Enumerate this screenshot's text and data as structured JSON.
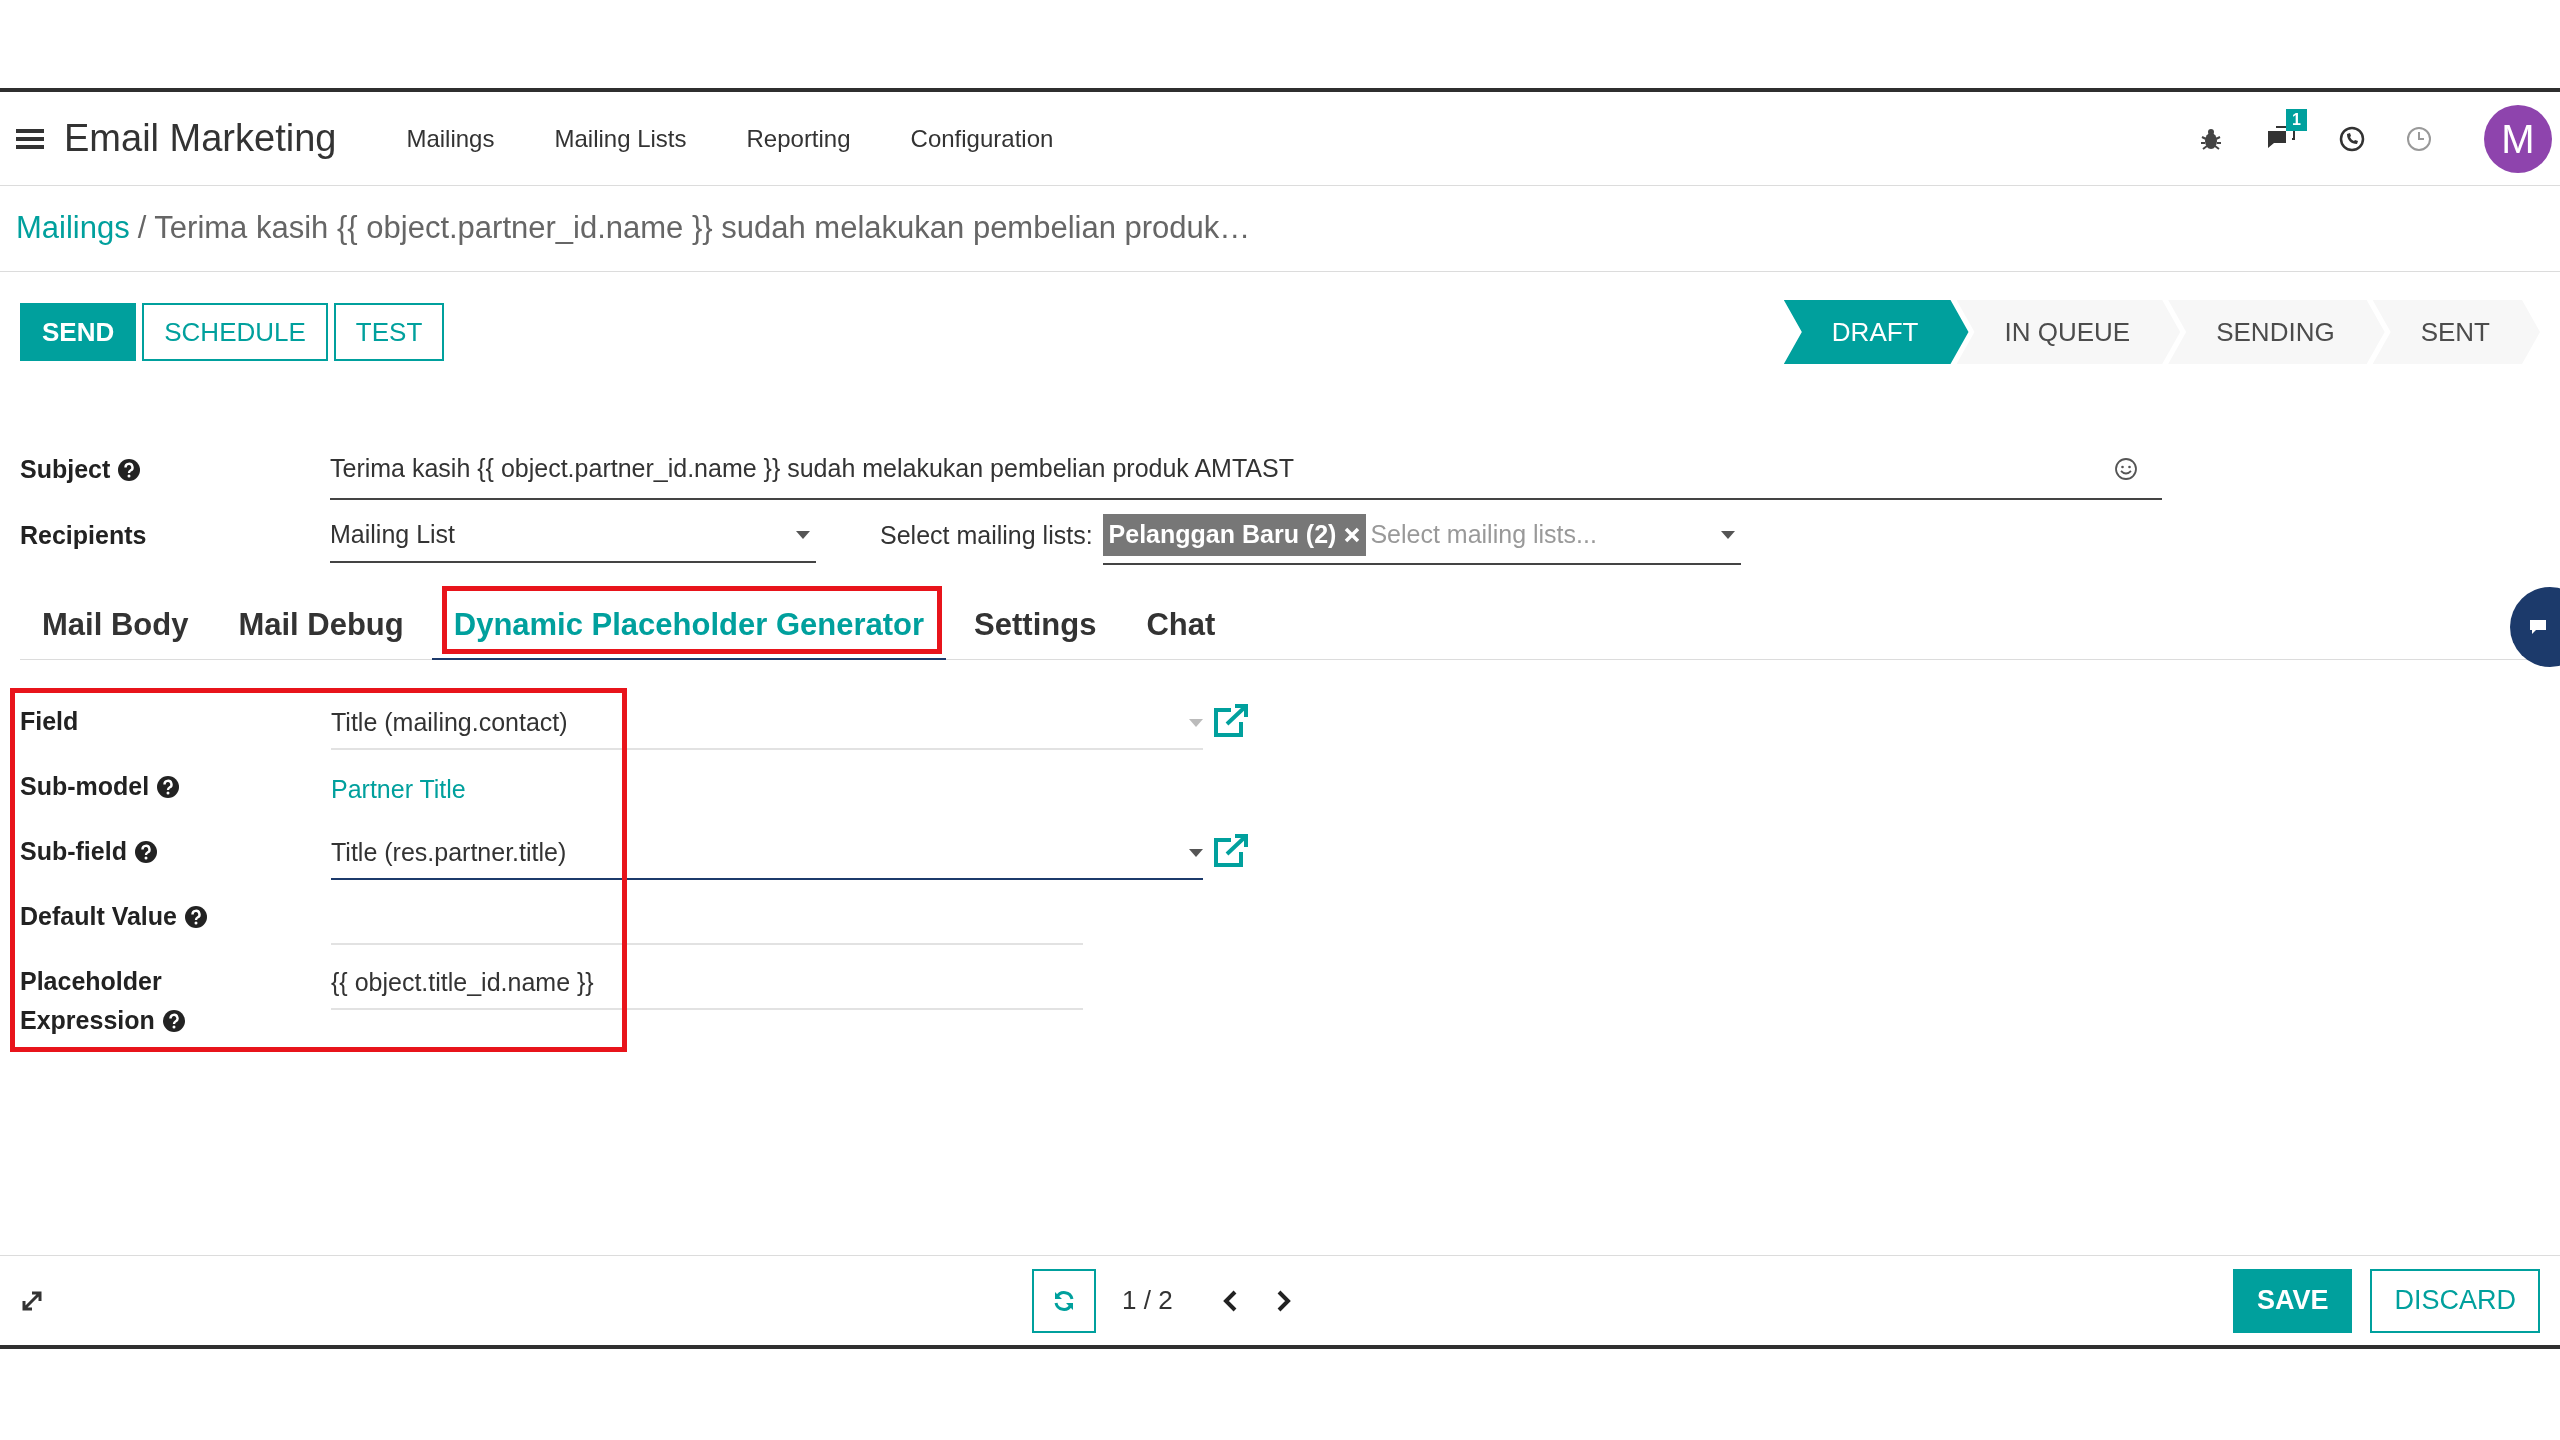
{
  "app_title": "Email Marketing",
  "menu": [
    "Mailings",
    "Mailing Lists",
    "Reporting",
    "Configuration"
  ],
  "systray": {
    "message_count": "1",
    "avatar_letter": "M"
  },
  "breadcrumb": {
    "parent": "Mailings",
    "separator": "/",
    "current": "Terima kasih {{ object.partner_id.name }} sudah melakukan pembelian produk…"
  },
  "actions": [
    {
      "label": "SEND",
      "kind": "primary"
    },
    {
      "label": "SCHEDULE",
      "kind": "secondary"
    },
    {
      "label": "TEST",
      "kind": "secondary"
    }
  ],
  "stages": [
    {
      "label": "DRAFT",
      "selected": true
    },
    {
      "label": "IN QUEUE",
      "selected": false
    },
    {
      "label": "SENDING",
      "selected": false
    },
    {
      "label": "SENT",
      "selected": false
    }
  ],
  "subject": {
    "label": "Subject",
    "help": true,
    "value": "Terima kasih {{ object.partner_id.name }} sudah melakukan pembelian produk AMTAST"
  },
  "recipients": {
    "label": "Recipients",
    "value": "Mailing List",
    "lists_label": "Select mailing lists:",
    "tags": [
      "Pelanggan Baru (2)"
    ],
    "placeholder": "Select mailing lists..."
  },
  "tabs": [
    {
      "label": "Mail Body",
      "selected": false,
      "highlighted": false
    },
    {
      "label": "Mail Debug",
      "selected": false,
      "highlighted": false
    },
    {
      "label": "Dynamic Placeholder Generator",
      "selected": true,
      "highlighted": true
    },
    {
      "label": "Settings",
      "selected": false,
      "highlighted": false
    },
    {
      "label": "Chat",
      "selected": false,
      "highlighted": false
    }
  ],
  "fields_highlighted": true,
  "fields": [
    {
      "label": "Field",
      "help": false,
      "kind": "select",
      "value": "Title (mailing.contact)",
      "focused": false
    },
    {
      "label": "Sub-model",
      "help": true,
      "kind": "link",
      "value": "Partner Title"
    },
    {
      "label": "Sub-field",
      "help": true,
      "kind": "select",
      "value": "Title (res.partner.title)",
      "focused": true
    },
    {
      "label": "Default Value",
      "help": true,
      "kind": "text"
    },
    {
      "label": "Placeholder Expression",
      "help": true,
      "kind": "text",
      "value": "{{ object.title_id.name }}"
    }
  ],
  "pager": "1 / 2",
  "footer_buttons": [
    {
      "label": "SAVE",
      "kind": "primary"
    },
    {
      "label": "DISCARD",
      "kind": "secondary"
    }
  ]
}
